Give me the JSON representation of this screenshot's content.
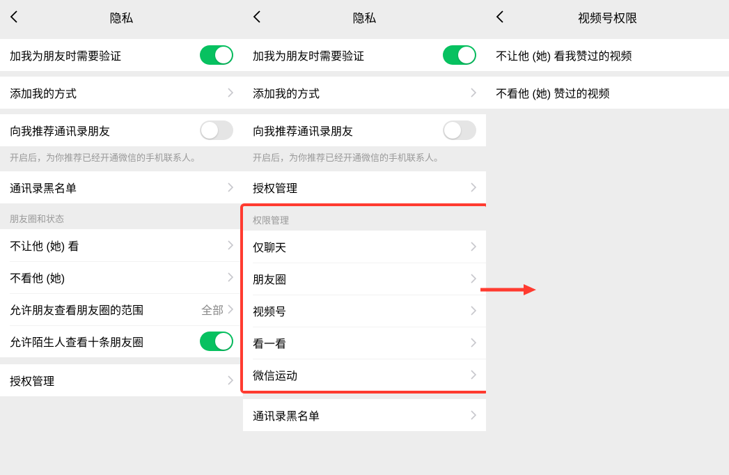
{
  "panel1": {
    "title": "隐私",
    "cells": {
      "verify": "加我为朋友时需要验证",
      "addMethod": "添加我的方式",
      "recommend": "向我推荐通讯录朋友",
      "recommendFooter": "开启后，为你推荐已经开通微信的手机联系人。",
      "blacklist": "通讯录黑名单",
      "sectionHeader": "朋友圈和状态",
      "hideFromHim": "不让他 (她) 看",
      "dontSeeHim": "不看他 (她)",
      "momentsRange": "允许朋友查看朋友圈的范围",
      "momentsRangeValue": "全部",
      "strangerTen": "允许陌生人查看十条朋友圈",
      "authManage": "授权管理"
    }
  },
  "panel2": {
    "title": "隐私",
    "cells": {
      "verify": "加我为朋友时需要验证",
      "addMethod": "添加我的方式",
      "recommend": "向我推荐通讯录朋友",
      "recommendFooter": "开启后，为你推荐已经开通微信的手机联系人。",
      "authManage": "授权管理",
      "permSection": "权限管理",
      "chatOnly": "仅聊天",
      "moments": "朋友圈",
      "channel": "视频号",
      "topStories": "看一看",
      "werun": "微信运动",
      "blacklist": "通讯录黑名单"
    }
  },
  "panel3": {
    "title": "视频号权限",
    "cells": {
      "hideMyLikes": "不让他 (她) 看我赞过的视频",
      "dontSeeLikes": "不看他 (她) 赞过的视频"
    }
  }
}
